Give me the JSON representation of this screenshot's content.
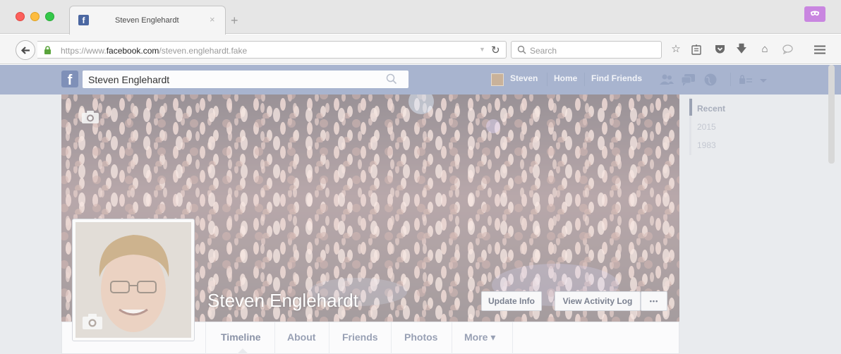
{
  "browser": {
    "tab_title": "Steven Englehardt",
    "tab_close": "×",
    "new_tab": "+",
    "url_prefix": "https://www.",
    "url_domain": "facebook.com",
    "url_path": "/steven.englehardt.fake",
    "search_placeholder": "Search",
    "toolbar_icons": [
      "star-icon",
      "reading-list-icon",
      "pocket-icon",
      "download-icon",
      "home-icon",
      "chat-icon",
      "menu-icon"
    ]
  },
  "facebook": {
    "logo": "f",
    "search_value": "Steven Englehardt",
    "nav": {
      "user": "Steven",
      "home": "Home",
      "find_friends": "Find Friends"
    },
    "profile": {
      "name": "Steven Englehardt",
      "update_info": "Update Info",
      "view_activity_log": "View Activity Log",
      "more_dots": "•••"
    },
    "tabs": [
      "Timeline",
      "About",
      "Friends",
      "Photos",
      "More ▾"
    ],
    "sidebar_years": [
      "Recent",
      "2015",
      "1983"
    ]
  },
  "colors": {
    "fb_bar": "#a8b4cf",
    "masked_icon": "#c986e0"
  }
}
